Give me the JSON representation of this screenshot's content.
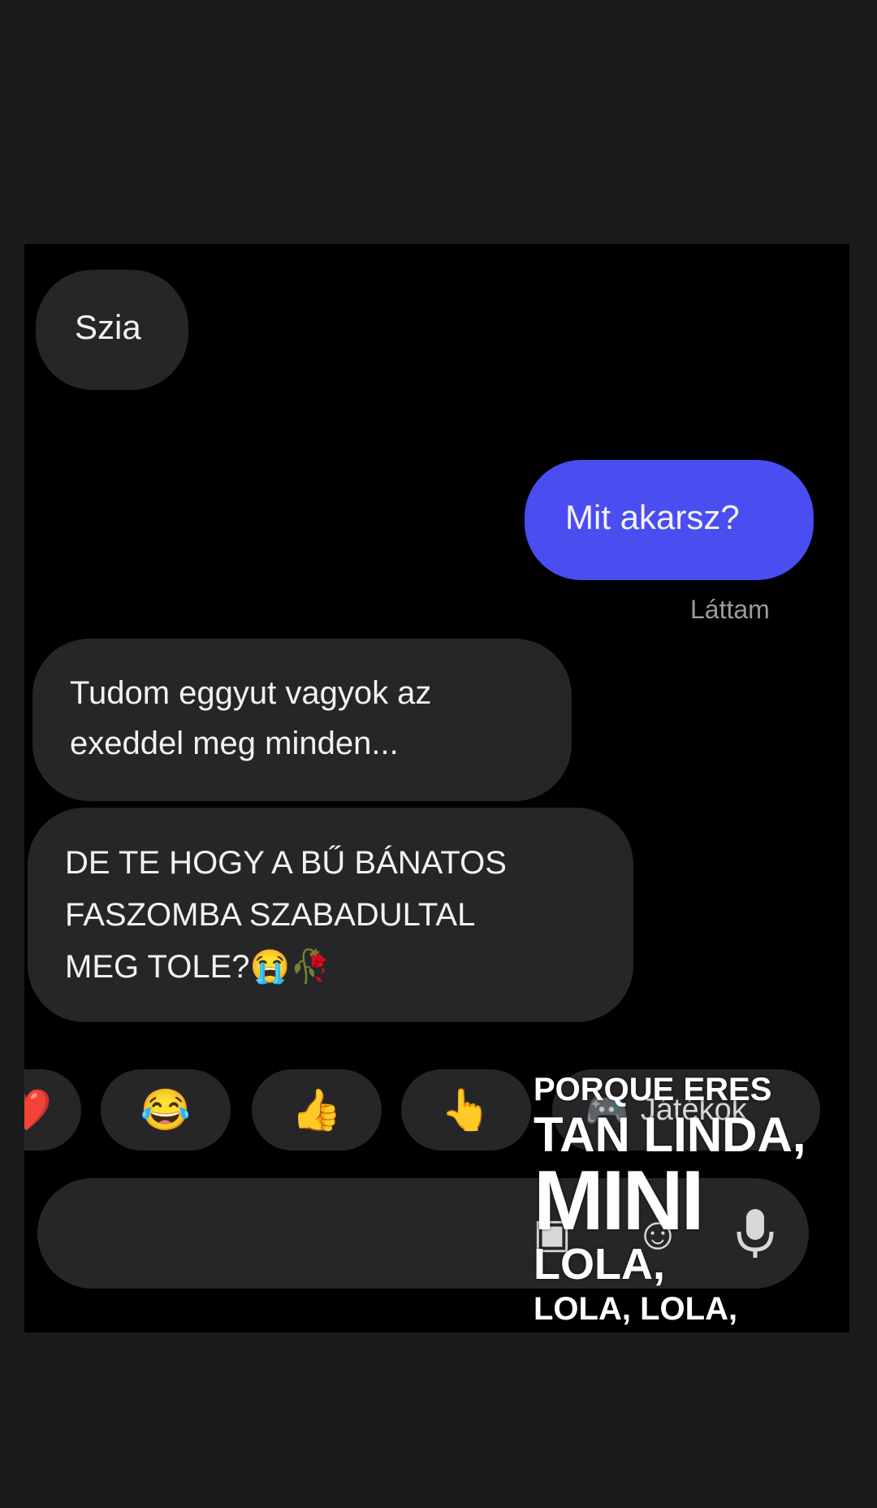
{
  "messages": [
    {
      "sender": "other",
      "lines": [
        "Szia"
      ]
    },
    {
      "sender": "me",
      "lines": [
        "Mit akarsz?"
      ]
    },
    {
      "sender": "other",
      "lines": [
        "Tudom eggyut vagyok az",
        "exeddel meg minden..."
      ]
    },
    {
      "sender": "other",
      "lines": [
        "DE TE HOGY A BŰ BÁNATOS",
        "FASZOMBA SZABADULTAL",
        "MEG TOLE?😭🥀"
      ]
    }
  ],
  "seen_label": "Láttam",
  "quick_reactions": [
    "❤️",
    "😂",
    "👍",
    "👆"
  ],
  "games_chip": {
    "icon": "gamepad-icon",
    "label": "Játékok"
  },
  "input_icons": [
    "image-icon",
    "sticker-icon",
    "microphone-icon"
  ],
  "overlay_text": {
    "line1": "PORQUE ERES",
    "line2": "TAN LINDA,",
    "line3": "MINI",
    "line4": "LOLA,",
    "line5": "LOLA, LOLA,"
  },
  "colors": {
    "background": "#1b1b1d",
    "chat_background": "#000000",
    "incoming_bubble": "#262628",
    "outgoing_bubble": "#4a4ef0",
    "seen_text": "#9a9a9a"
  }
}
